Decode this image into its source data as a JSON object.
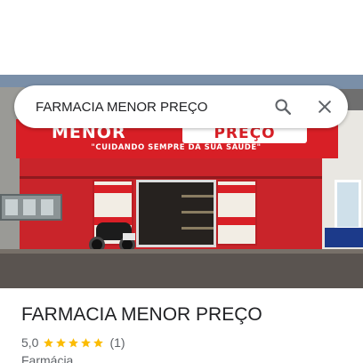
{
  "search": {
    "value": "FARMACIA MENOR PREÇO"
  },
  "hero_photo": {
    "sign_left": "MENOR",
    "sign_right": "PREÇO",
    "slogan": "\"CUIDANDO SEMPRE DA SUA SAÚDE\""
  },
  "place": {
    "name": "FARMACIA MENOR PREÇO",
    "rating": "5,0",
    "rating_stars": 5,
    "review_count": "(1)",
    "category": "Farmácia"
  },
  "colors": {
    "star": "#fbbc04",
    "sign_red": "#d81f26",
    "icon_gray": "#5f6368"
  },
  "icons": [
    "search-icon",
    "close-icon",
    "star-icon"
  ]
}
